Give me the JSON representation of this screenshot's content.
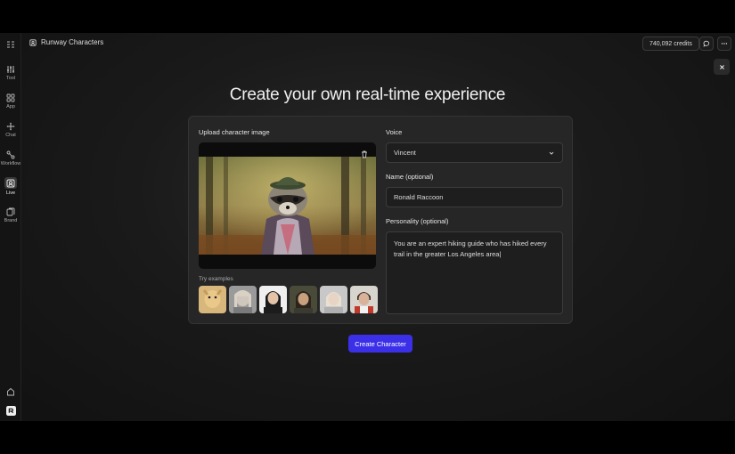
{
  "app": {
    "title": "Runway Characters"
  },
  "header": {
    "credits": "740,092 credits"
  },
  "sidebar": {
    "items": [
      {
        "label": "Tool",
        "icon": "sliders-icon"
      },
      {
        "label": "App",
        "icon": "grid-icon"
      },
      {
        "label": "Chat",
        "icon": "chat-icon"
      },
      {
        "label": "Workflow",
        "icon": "workflow-icon"
      },
      {
        "label": "Live",
        "icon": "live-icon",
        "active": true
      },
      {
        "label": "Brand",
        "icon": "brand-icon"
      }
    ]
  },
  "main": {
    "title": "Create your own real-time experience",
    "upload_label": "Upload character image",
    "examples_label": "Try examples",
    "voice_label": "Voice",
    "voice_value": "Vincent",
    "name_label": "Name (optional)",
    "name_value": "Ronald Raccoon",
    "personality_label": "Personality (optional)",
    "personality_value": "You are an expert hiking guide who has hiked every trail in the greater Los Angeles area|",
    "create_button": "Create Character"
  },
  "colors": {
    "accent": "#3b30e8"
  }
}
